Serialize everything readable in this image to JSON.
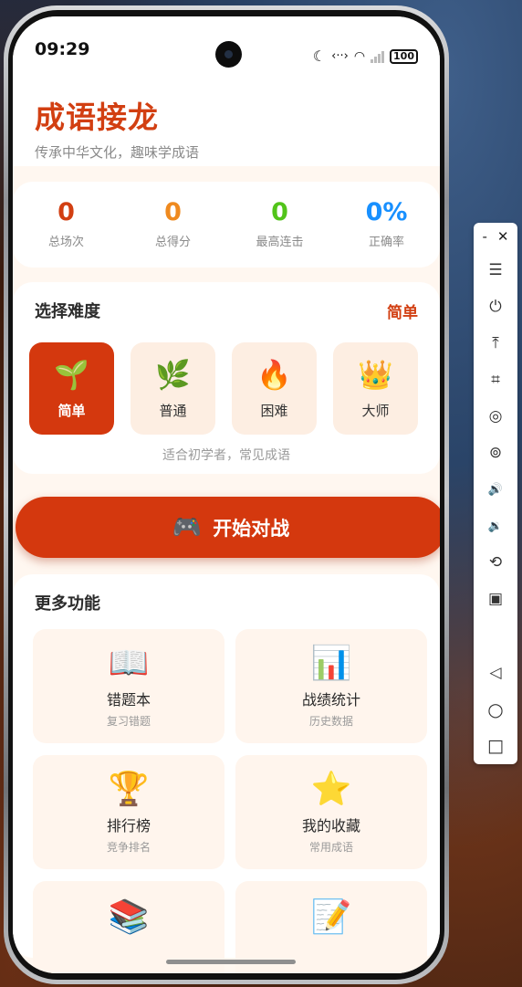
{
  "status": {
    "time": "09:29",
    "battery": "100",
    "icons": [
      "moon-icon",
      "data-transfer-icon",
      "wifi-icon",
      "signal-icon",
      "battery-icon"
    ]
  },
  "app": {
    "title": "成语接龙",
    "subtitle": "传承中华文化，趣味学成语"
  },
  "stats": [
    {
      "value": "0",
      "label": "总场次",
      "color": "#d23f12"
    },
    {
      "value": "0",
      "label": "总得分",
      "color": "#ef8a1f"
    },
    {
      "value": "0",
      "label": "最高连击",
      "color": "#52c41a"
    },
    {
      "value": "0%",
      "label": "正确率",
      "color": "#1890ff"
    }
  ],
  "difficulty": {
    "title": "选择难度",
    "current": "简单",
    "levels": [
      {
        "icon": "🌱",
        "icon_name": "seedling-icon",
        "label": "简单",
        "active": true
      },
      {
        "icon": "🌿",
        "icon_name": "herb-icon",
        "label": "普通",
        "active": false
      },
      {
        "icon": "🔥",
        "icon_name": "fire-icon",
        "label": "困难",
        "active": false
      },
      {
        "icon": "👑",
        "icon_name": "crown-icon",
        "label": "大师",
        "active": false
      }
    ],
    "hint": "适合初学者，常见成语"
  },
  "start_button": {
    "icon": "🎮",
    "icon_name": "game-controller-icon",
    "label": "开始对战"
  },
  "more": {
    "title": "更多功能",
    "features": [
      {
        "icon": "📖",
        "icon_name": "open-book-icon",
        "title": "错题本",
        "subtitle": "复习错题"
      },
      {
        "icon": "📊",
        "icon_name": "bar-chart-icon",
        "title": "战绩统计",
        "subtitle": "历史数据"
      },
      {
        "icon": "🏆",
        "icon_name": "trophy-icon",
        "title": "排行榜",
        "subtitle": "竞争排名"
      },
      {
        "icon": "⭐",
        "icon_name": "star-icon",
        "title": "我的收藏",
        "subtitle": "常用成语"
      },
      {
        "icon": "📚",
        "icon_name": "books-icon",
        "title": "",
        "subtitle": ""
      },
      {
        "icon": "📝",
        "icon_name": "memo-icon",
        "title": "",
        "subtitle": ""
      }
    ]
  },
  "emulator_toolbar": {
    "minimize": "-",
    "close": "✕",
    "items": [
      {
        "name": "menu-icon",
        "glyph": "☰"
      },
      {
        "name": "power-icon",
        "glyph": "⏻"
      },
      {
        "name": "upload-icon",
        "glyph": "⤒"
      },
      {
        "name": "crop-icon",
        "glyph": "⌗"
      },
      {
        "name": "camera-icon",
        "glyph": "◎"
      },
      {
        "name": "screenshot-icon",
        "glyph": "⊚"
      },
      {
        "name": "volume-up-icon",
        "glyph": "🔊"
      },
      {
        "name": "volume-down-icon",
        "glyph": "🔉"
      },
      {
        "name": "rotate-icon",
        "glyph": "⟲"
      },
      {
        "name": "device-icon",
        "glyph": "▣"
      },
      {
        "name": "back-icon",
        "glyph": "◁"
      },
      {
        "name": "home-icon",
        "glyph": "○"
      },
      {
        "name": "recents-icon",
        "glyph": "□"
      }
    ]
  }
}
